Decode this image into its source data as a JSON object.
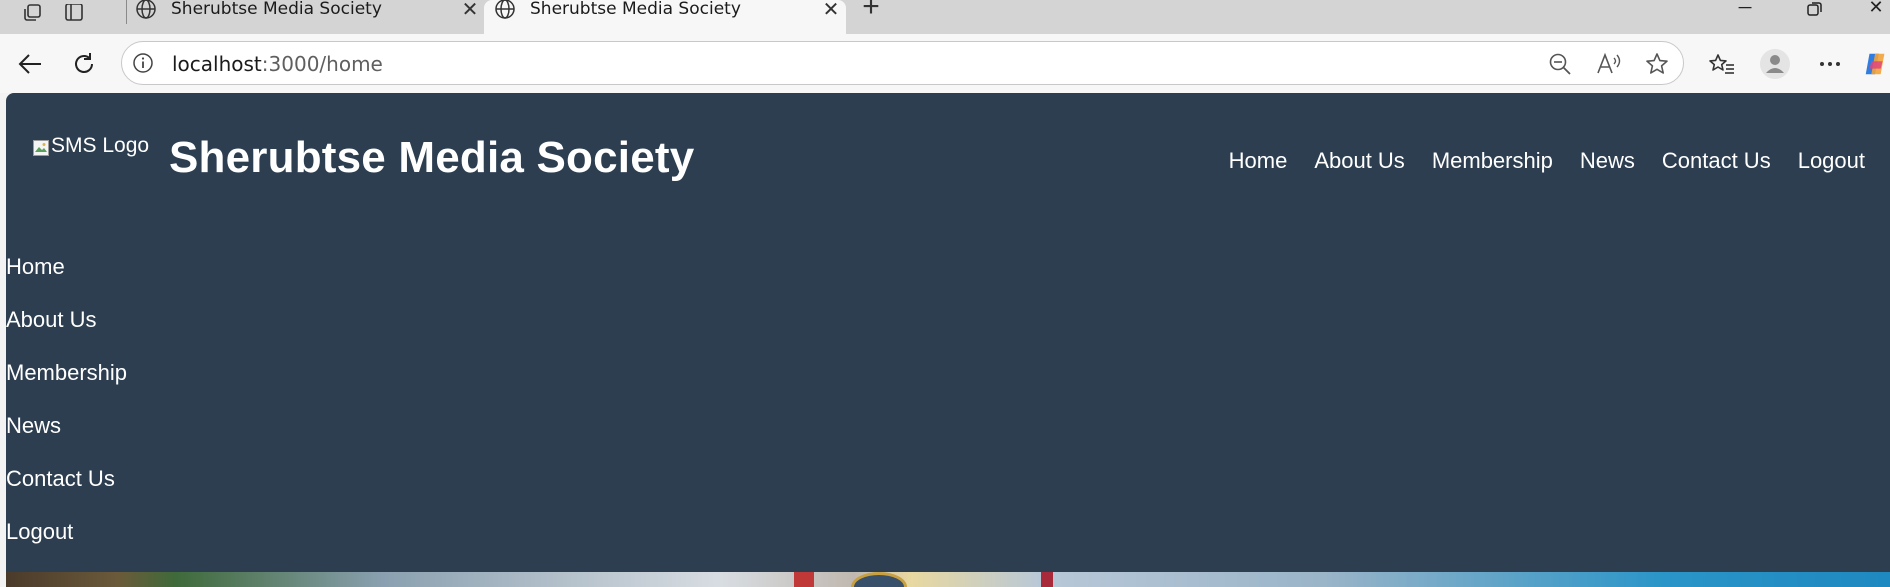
{
  "browser": {
    "tabs": [
      {
        "title": "Sherubtse Media Society",
        "active": false
      },
      {
        "title": "Sherubtse Media Society",
        "active": true
      }
    ],
    "address": {
      "host": "localhost",
      "path": ":3000/home"
    },
    "icons": [
      "workspaces-icon",
      "tab-actions-icon",
      "globe-icon",
      "close-icon",
      "new-tab-icon",
      "minimize-icon",
      "restore-icon",
      "back-icon",
      "refresh-icon",
      "site-info-icon",
      "zoom-out-icon",
      "read-aloud-icon",
      "favorite-star-icon",
      "favorites-icon",
      "profile-icon",
      "more-icon",
      "copilot-icon"
    ]
  },
  "site": {
    "logo_alt": "SMS Logo",
    "title": "Sherubtse Media Society",
    "top_nav": [
      "Home",
      "About Us",
      "Membership",
      "News",
      "Contact Us",
      "Logout"
    ],
    "side_nav": [
      "Home",
      "About Us",
      "Membership",
      "News",
      "Contact Us",
      "Logout"
    ]
  },
  "colors": {
    "header_bg": "#2c3e50",
    "nav_text": "#ffffff",
    "chrome_bg": "#d4d4d4",
    "toolbar_bg": "#f7f7f7"
  }
}
